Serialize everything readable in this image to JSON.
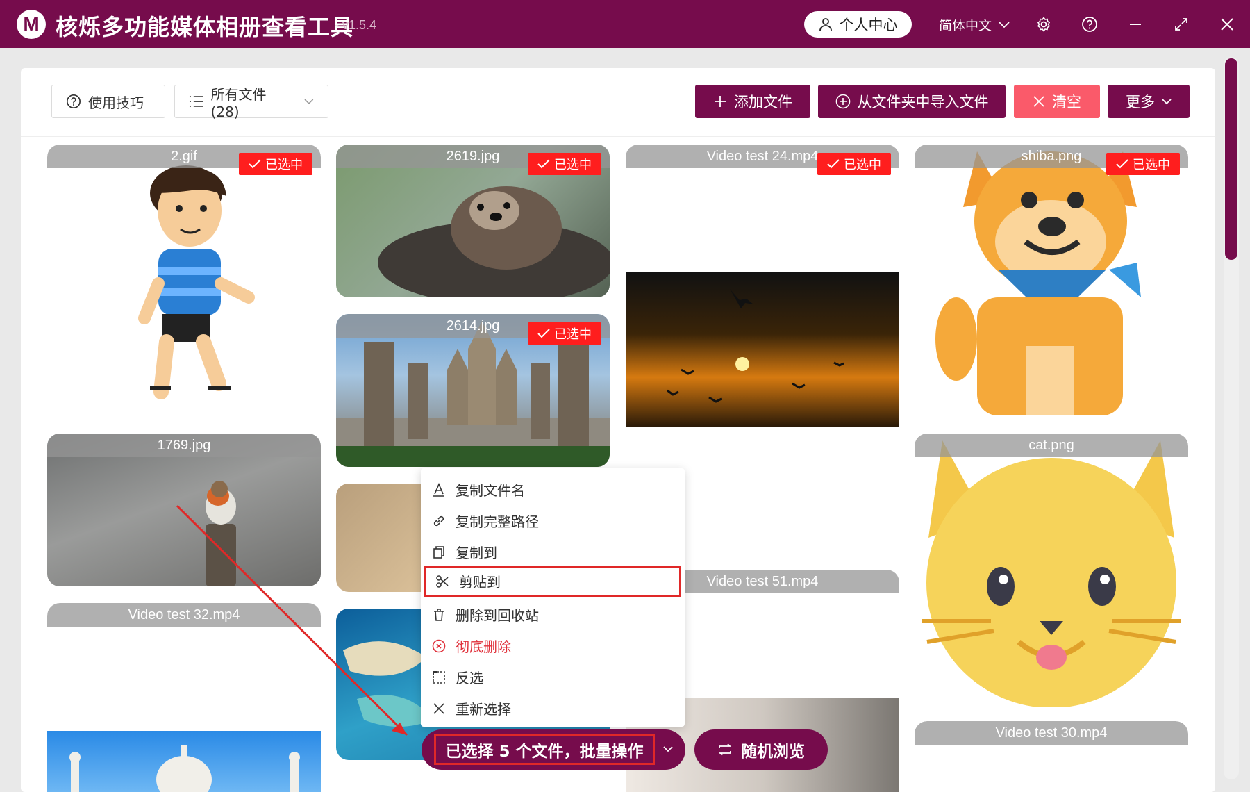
{
  "app": {
    "logo_letter": "M",
    "title": "核烁多功能媒体相册查看工具",
    "version": "- v1.5.4",
    "user_center": "个人中心",
    "language": "简体中文"
  },
  "toolbar": {
    "tips_label": "使用技巧",
    "filter_label": "所有文件 (28)",
    "add_file_label": "添加文件",
    "import_folder_label": "从文件夹中导入文件",
    "clear_label": "清空",
    "more_label": "更多"
  },
  "colors": {
    "brand": "#760c4c",
    "danger": "#ff1e1e",
    "clear_button": "#fa5a6a"
  },
  "selected_badge": "已选中",
  "tiles": [
    {
      "name": "2.gif",
      "selected": true
    },
    {
      "name": "2619.jpg",
      "selected": true
    },
    {
      "name": "Video test 24.mp4",
      "selected": true
    },
    {
      "name": "shiba.png",
      "selected": true
    },
    {
      "name": "2614.jpg",
      "selected": true
    },
    {
      "name": "1769.jpg",
      "selected": false
    },
    {
      "name": "cat.png",
      "selected": false
    },
    {
      "name": "Video test 51.mp4",
      "selected": false
    },
    {
      "name": "Video test 32.mp4",
      "selected": false
    },
    {
      "name": "Video test 30.mp4",
      "selected": false
    }
  ],
  "context_menu": {
    "items": [
      {
        "label": "复制文件名",
        "icon": "text-a-icon"
      },
      {
        "label": "复制完整路径",
        "icon": "link-icon"
      },
      {
        "label": "复制到",
        "icon": "copy-icon"
      },
      {
        "label": "剪贴到",
        "icon": "scissors-icon"
      },
      {
        "label": "删除到回收站",
        "icon": "trash-icon"
      },
      {
        "label": "彻底删除",
        "icon": "circle-x-icon"
      },
      {
        "label": "反选",
        "icon": "invert-select-icon"
      },
      {
        "label": "重新选择",
        "icon": "x-icon"
      }
    ]
  },
  "bottom": {
    "batch_label": "已选择 5 个文件，批量操作",
    "random_label": "随机浏览"
  }
}
